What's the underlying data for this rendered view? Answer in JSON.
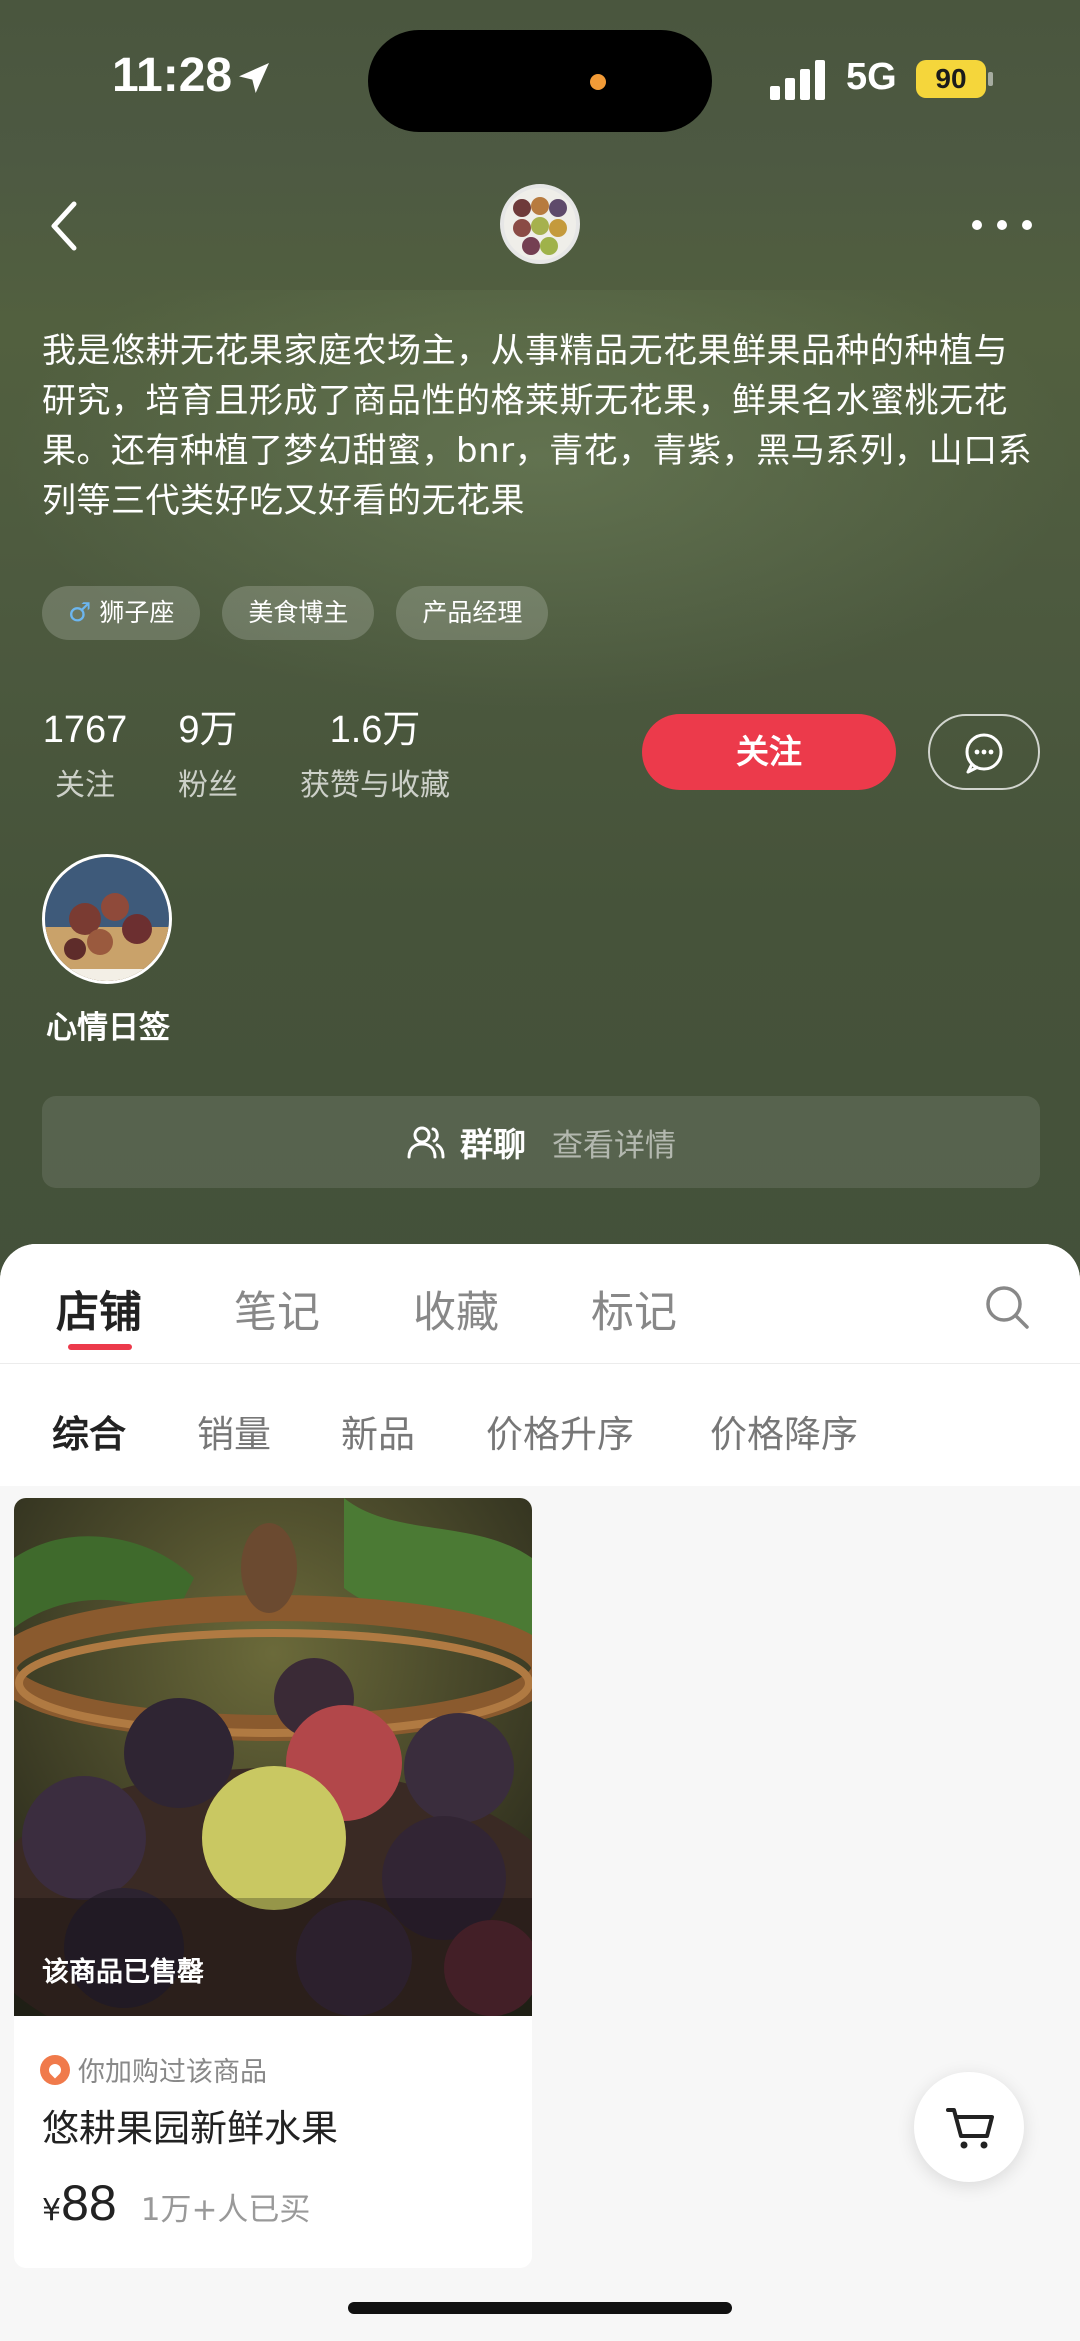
{
  "status": {
    "time": "11:28",
    "network": "5G",
    "battery": "90"
  },
  "profile": {
    "bio": "我是悠耕无花果家庭农场主，从事精品无花果鲜果品种的种植与研究，培育且形成了商品性的格莱斯无花果，鲜果名水蜜桃无花果。还有种植了梦幻甜蜜，bnr，青花，青紫，黑马系列，山口系列等三代类好吃又好看的无花果",
    "tags": [
      "狮子座",
      "美食博主",
      "产品经理"
    ],
    "gender_symbol": "♂",
    "stats": [
      {
        "num": "1767",
        "label": "关注"
      },
      {
        "num": "9万",
        "label": "粉丝"
      },
      {
        "num": "1.6万",
        "label": "获赞与收藏"
      }
    ],
    "follow_label": "关注",
    "mood_label": "心情日签",
    "group_chat": {
      "title": "群聊",
      "detail": "查看详情"
    }
  },
  "tabs": [
    "店铺",
    "笔记",
    "收藏",
    "标记"
  ],
  "filters": [
    "综合",
    "销量",
    "新品",
    "价格升序",
    "价格降序"
  ],
  "product": {
    "sold_out": "该商品已售罄",
    "bought_before": "你加购过该商品",
    "title": "悠耕果园新鲜水果",
    "currency": "¥",
    "price": "88",
    "sold_count": "1万+人已买"
  },
  "icons": {
    "back": "back-chevron-icon",
    "more": "more-dots-icon",
    "message": "message-bubble-icon",
    "group": "group-people-icon",
    "search": "search-icon",
    "cart": "shopping-cart-icon"
  },
  "colors": {
    "accent": "#ec3a4b",
    "header_bg": "#4d5a3f"
  }
}
